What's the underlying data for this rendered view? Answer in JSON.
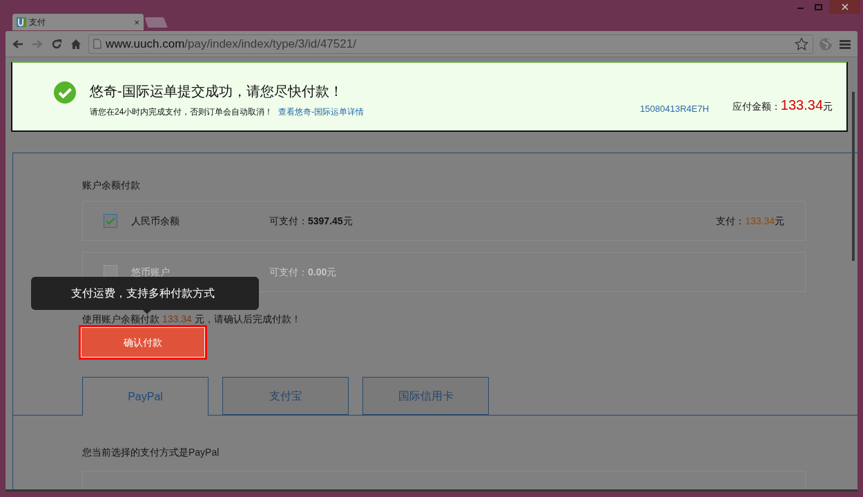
{
  "browser": {
    "tab_title": "支付",
    "tab_close": "×",
    "url_host": "www.uuch.com",
    "url_path": "/pay/index/index/type/3/id/47521/"
  },
  "banner": {
    "title": "悠奇-国际运单提交成功，请您尽快付款！",
    "notice": "请您在24小时内完成支付，否则订单会自动取消！",
    "detail_link": "查看悠奇-国际运单详情",
    "order_no": "15080413R4E7H",
    "amount_label": "应付金额：",
    "amount": "133.34",
    "currency": "元"
  },
  "balance": {
    "heading": "账户余额付款",
    "accounts": [
      {
        "name": "人民币余额",
        "checked": true,
        "disabled": false,
        "available_label": "可支付：",
        "available": "5397.45",
        "currency": "元",
        "pay_label": "支付：",
        "pay": "133.34",
        "pay_currency": "元"
      },
      {
        "name": "悠币账户",
        "checked": false,
        "disabled": true,
        "available_label": "可支付：",
        "available": "0.00",
        "currency": "元"
      }
    ],
    "confirm_prefix": "使用账户余额付款 ",
    "confirm_amount": "133.34",
    "confirm_suffix": " 元，请确认后完成付款！",
    "confirm_button": "确认付款"
  },
  "tooltip": "支付运费，支持多种付款方式",
  "methods": {
    "tabs": [
      {
        "label": "PayPal",
        "selected": true
      },
      {
        "label": "支付宝",
        "selected": false
      },
      {
        "label": "国际信用卡",
        "selected": false
      }
    ],
    "current_label": "您当前选择的支付方式是",
    "current_value": "PayPal"
  }
}
